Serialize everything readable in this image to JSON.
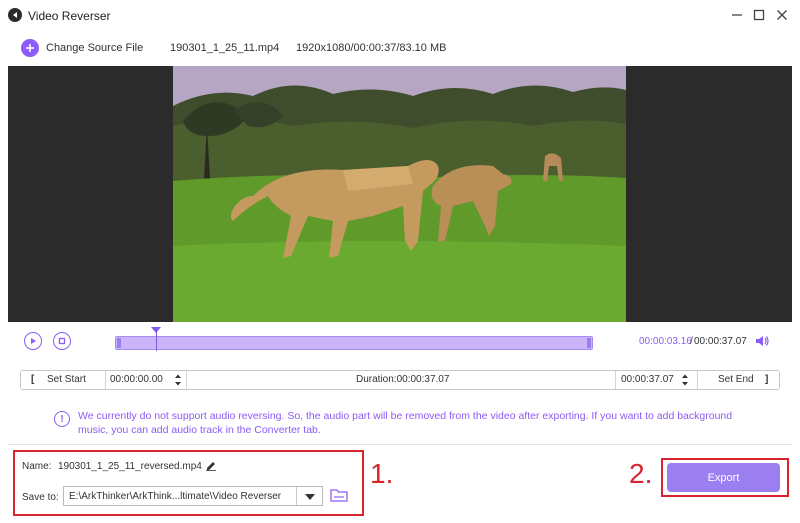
{
  "window": {
    "title": "Video Reverser"
  },
  "source": {
    "change_label": "Change Source File",
    "file_name": "190301_1_25_11.mp4",
    "file_info": "1920x1080/00:00:37/83.10 MB"
  },
  "playback": {
    "current_time": "00:00:03.16",
    "separator": "/",
    "total_time": "00:00:37.07",
    "playhead_fraction": 0.085
  },
  "range": {
    "set_start_label": "Set Start",
    "start_time": "00:00:00.00",
    "duration": "Duration:00:00:37.07",
    "end_time": "00:00:37.07",
    "set_end_label": "Set End",
    "bracket_open": "[",
    "bracket_close": "]"
  },
  "notice": {
    "icon_glyph": "!",
    "text": "We currently do not support audio reversing. So, the audio part will be removed from the video after exporting. If you want to add background music, you can add audio track in the Converter tab."
  },
  "output": {
    "name_label": "Name:",
    "name_value": "190301_1_25_11_reversed.mp4",
    "save_label": "Save to:",
    "save_path": "E:\\ArkThinker\\ArkThink...ltimate\\Video Reverser",
    "export_label": "Export"
  },
  "annotations": {
    "step1": "1.",
    "step2": "2."
  },
  "colors": {
    "accent": "#8b5cf6",
    "highlight": "#d9232e",
    "timeline_fill": "#c9b5f7"
  }
}
